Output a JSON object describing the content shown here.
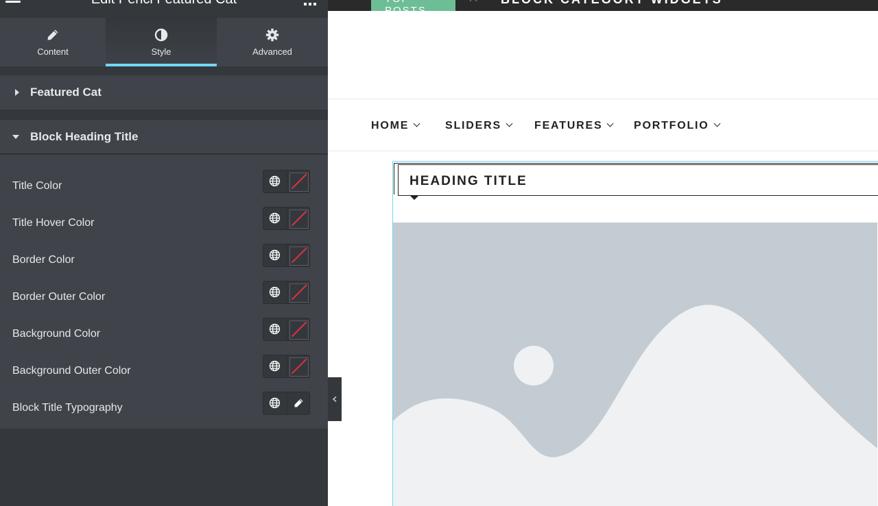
{
  "panel": {
    "title": "Edit Penci Featured Cat",
    "tabs": [
      {
        "label": "Content",
        "icon": "pencil-icon",
        "active": false
      },
      {
        "label": "Style",
        "icon": "contrast-icon",
        "active": true
      },
      {
        "label": "Advanced",
        "icon": "gear-icon",
        "active": false
      }
    ],
    "sections": [
      {
        "label": "Featured Cat",
        "expanded": false
      },
      {
        "label": "Block Heading Title",
        "expanded": true
      }
    ],
    "controls": [
      {
        "label": "Title Color",
        "type": "color"
      },
      {
        "label": "Title Hover Color",
        "type": "color"
      },
      {
        "label": "Border Color",
        "type": "color"
      },
      {
        "label": "Border Outer Color",
        "type": "color"
      },
      {
        "label": "Background Color",
        "type": "color"
      },
      {
        "label": "Background Outer Color",
        "type": "color"
      },
      {
        "label": "Block Title Typography",
        "type": "typography"
      }
    ]
  },
  "preview": {
    "topbar": {
      "badge": "TOP POSTS",
      "arrows": "‹  ›",
      "title": "BLOCK CATEGORY WIDGETS"
    },
    "nav": [
      "HOME",
      "SLIDERS",
      "FEATURES",
      "PORTFOLIO"
    ],
    "heading_title": "HEADING TITLE"
  },
  "colors": {
    "panel_bg": "#34383c",
    "section_bg": "#404349",
    "active_tab_accent": "#71d7f7",
    "none_swatch_slash": "#e2303f",
    "topbar_badge": "#6dbd96",
    "image_placeholder": "#c4ccd3"
  }
}
